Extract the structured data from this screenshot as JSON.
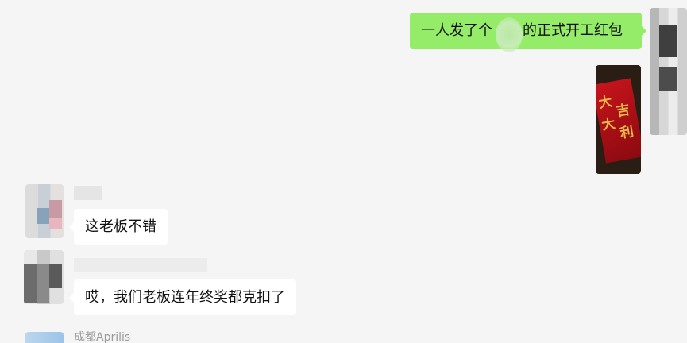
{
  "messages": [
    {
      "direction": "outgoing",
      "type": "text",
      "text_before": "一人发了个",
      "text_after": "的正式开工红包"
    },
    {
      "direction": "outgoing",
      "type": "image",
      "image_desc_icon": "red-envelope-photo"
    },
    {
      "direction": "incoming",
      "type": "text",
      "text": "这老板不错"
    },
    {
      "direction": "incoming",
      "type": "text",
      "text": "哎，我们老板连年终奖都克扣了"
    },
    {
      "direction": "incoming",
      "type": "name_only",
      "sender": "成都Aprilis"
    }
  ],
  "photo": {
    "glyphs": [
      "大",
      "吉",
      "大",
      "利"
    ]
  },
  "colors": {
    "background": "#f5f5f5",
    "outgoing_bubble": "#95ec69",
    "incoming_bubble": "#ffffff",
    "sender_name": "#9a9a9a"
  }
}
